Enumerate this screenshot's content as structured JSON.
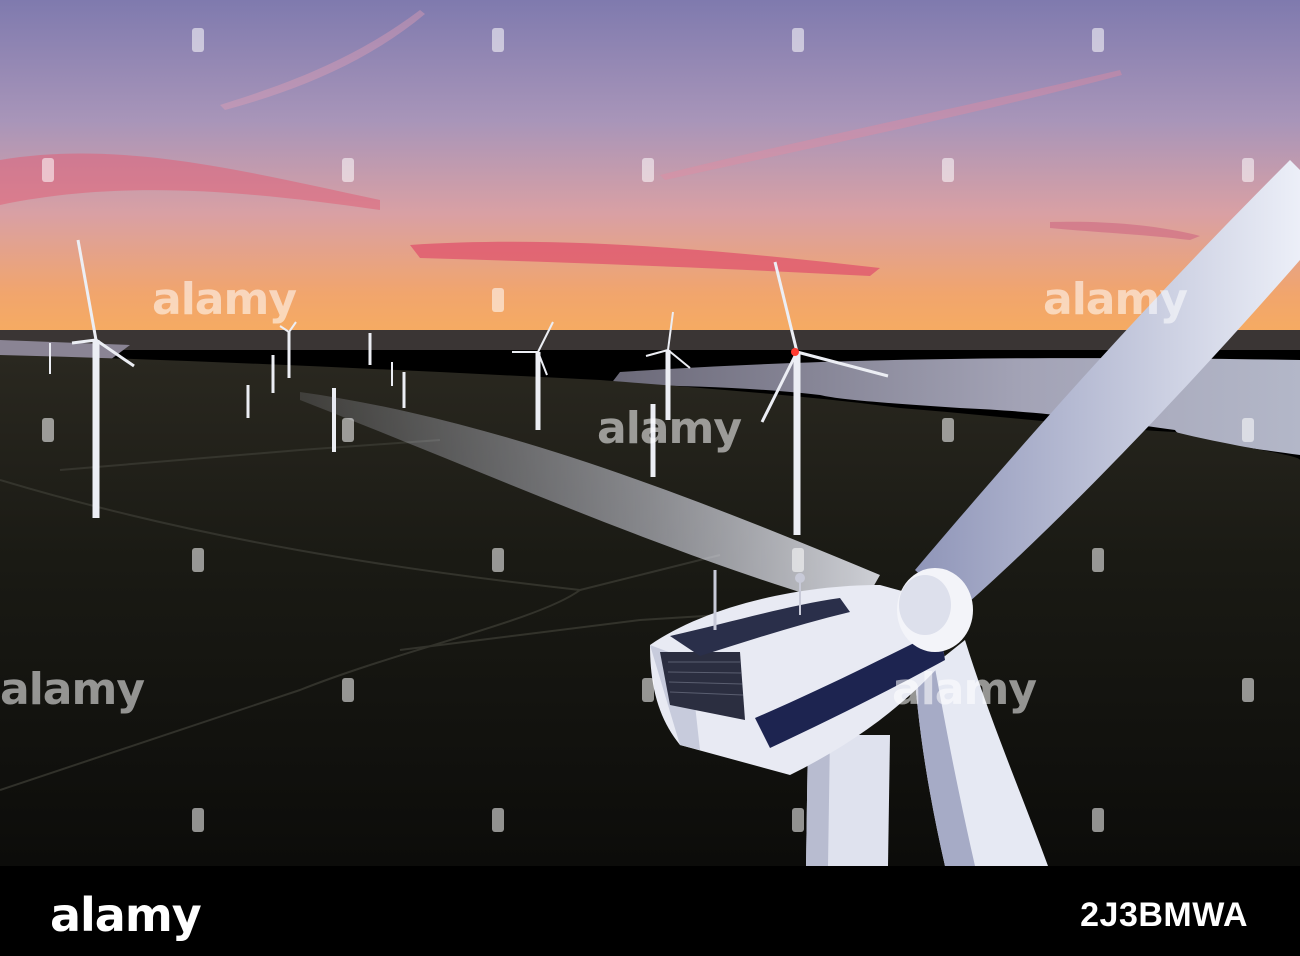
{
  "watermark": {
    "text": "alamy"
  },
  "footer": {
    "logo": "alamy",
    "image_id": "2J3BMWA"
  },
  "colors": {
    "sky_top": "#8e87b8",
    "sky_mid": "#c99aa8",
    "sky_horizon": "#f4a764",
    "cloud": "#e0627a",
    "ground": "#15150f",
    "water": "#9aa0b4",
    "turbine": "#f1f2f6",
    "nacelle_stripe": "#1d2450"
  }
}
